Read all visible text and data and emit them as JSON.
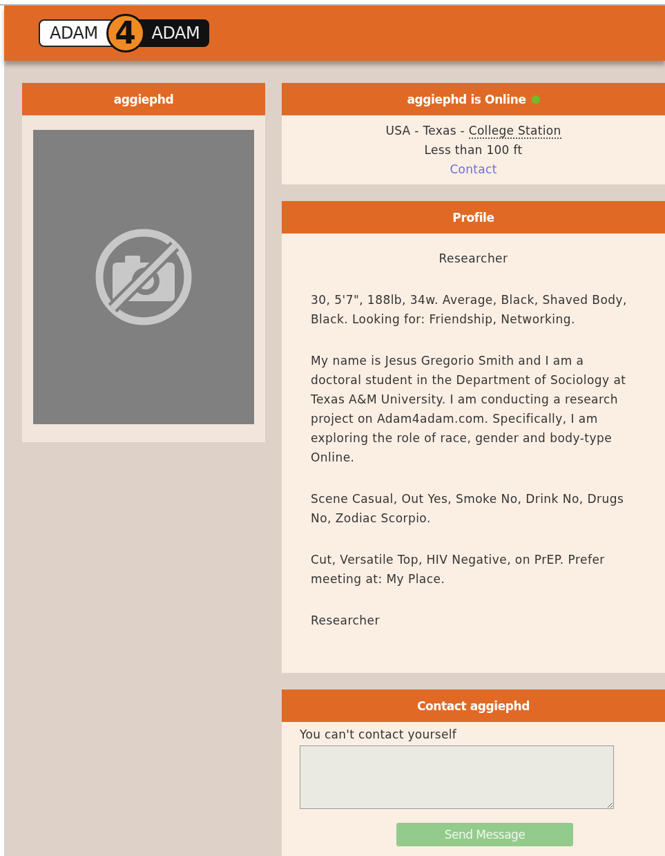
{
  "header": {
    "logo": {
      "left_word": "ADAM",
      "number": "4",
      "right_word": "ADAM"
    }
  },
  "photo_card": {
    "title": "aggiephd"
  },
  "status_card": {
    "title": "aggiephd is Online",
    "online": true,
    "location_prefix": "USA - Texas - ",
    "city": "College Station",
    "distance": "Less than 100 ft",
    "contact_link": "Contact"
  },
  "profile_card": {
    "title": "Profile",
    "paragraphs": [
      {
        "kind": "heading",
        "text": "Researcher"
      },
      {
        "kind": "text",
        "text": "30, 5'7\", 188lb, 34w. Average, Black, Shaved Body, Black. Looking for: Friendship, Networking."
      },
      {
        "kind": "text",
        "text": "My name is Jesus Gregorio Smith and I am a doctoral student in the Department of Sociology at Texas A&M University. I am conducting a research project on Adam4adam.com. Specifically, I am exploring the role of race, gender and body-type Online."
      },
      {
        "kind": "text",
        "text": "Scene Casual, Out Yes, Smoke No, Drink No, Drugs No, Zodiac Scorpio."
      },
      {
        "kind": "text",
        "text": "Cut, Versatile Top, HIV Negative, on PrEP. Prefer meeting at: My Place."
      },
      {
        "kind": "text",
        "text": "Researcher"
      }
    ]
  },
  "contact_card": {
    "title": "Contact aggiephd",
    "notice": "You can't contact yourself",
    "send_button": {
      "label": "Send Message",
      "disabled": true
    }
  }
}
